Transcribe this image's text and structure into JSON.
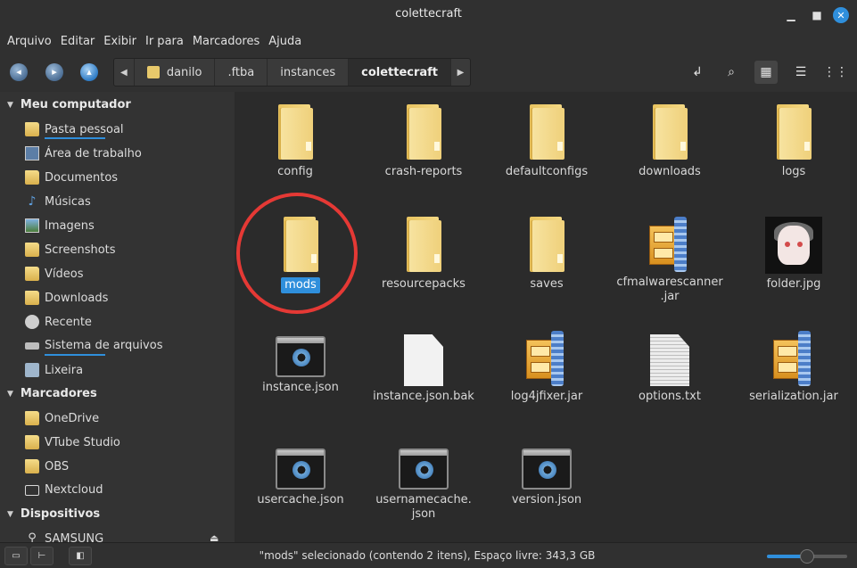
{
  "window": {
    "title": "colettecraft"
  },
  "menu": [
    "Arquivo",
    "Editar",
    "Exibir",
    "Ir para",
    "Marcadores",
    "Ajuda"
  ],
  "breadcrumb": [
    "danilo",
    ".ftba",
    "instances",
    "colettecraft"
  ],
  "sidebar": {
    "sections": [
      {
        "label": "Meu computador",
        "items": [
          {
            "label": "Pasta pessoal",
            "icon": "home-folder-icon",
            "usage": 0.5
          },
          {
            "label": "Área de trabalho",
            "icon": "desktop-icon"
          },
          {
            "label": "Documentos",
            "icon": "documents-folder-icon"
          },
          {
            "label": "Músicas",
            "icon": "music-icon"
          },
          {
            "label": "Imagens",
            "icon": "pictures-icon"
          },
          {
            "label": "Screenshots",
            "icon": "folder-icon"
          },
          {
            "label": "Vídeos",
            "icon": "videos-folder-icon"
          },
          {
            "label": "Downloads",
            "icon": "downloads-folder-icon"
          },
          {
            "label": "Recente",
            "icon": "recent-icon"
          },
          {
            "label": "Sistema de arquivos",
            "icon": "drive-icon",
            "usage": 0.5
          },
          {
            "label": "Lixeira",
            "icon": "trash-icon"
          }
        ]
      },
      {
        "label": "Marcadores",
        "items": [
          {
            "label": "OneDrive",
            "icon": "folder-icon"
          },
          {
            "label": "VTube Studio",
            "icon": "folder-icon"
          },
          {
            "label": "OBS",
            "icon": "folder-icon"
          },
          {
            "label": "Nextcloud",
            "icon": "folder-outline-icon"
          }
        ]
      },
      {
        "label": "Dispositivos",
        "items": [
          {
            "label": "SAMSUNG",
            "icon": "usb-icon"
          }
        ]
      }
    ]
  },
  "files": [
    {
      "name": "config",
      "type": "folder"
    },
    {
      "name": "crash-reports",
      "type": "folder"
    },
    {
      "name": "defaultconfigs",
      "type": "folder"
    },
    {
      "name": "downloads",
      "type": "folder"
    },
    {
      "name": "logs",
      "type": "folder"
    },
    {
      "name": "mods",
      "type": "folder",
      "selected": true
    },
    {
      "name": "resourcepacks",
      "type": "folder"
    },
    {
      "name": "saves",
      "type": "folder"
    },
    {
      "name": "cfmalwarescanner\n.jar",
      "type": "jar"
    },
    {
      "name": "folder.jpg",
      "type": "image"
    },
    {
      "name": "instance.json",
      "type": "json"
    },
    {
      "name": "instance.json.bak",
      "type": "blank"
    },
    {
      "name": "log4jfixer.jar",
      "type": "jar"
    },
    {
      "name": "options.txt",
      "type": "text"
    },
    {
      "name": "serialization.jar",
      "type": "jar"
    },
    {
      "name": "usercache.json",
      "type": "json"
    },
    {
      "name": "usernamecache.\njson",
      "type": "json"
    },
    {
      "name": "version.json",
      "type": "json"
    }
  ],
  "status": {
    "text": "\"mods\" selecionado (contendo 2 itens), Espaço livre: 343,3 GB"
  },
  "zoom": {
    "level": 0.5
  },
  "colors": {
    "accent": "#2f8fdc",
    "annotation": "#e53935"
  }
}
